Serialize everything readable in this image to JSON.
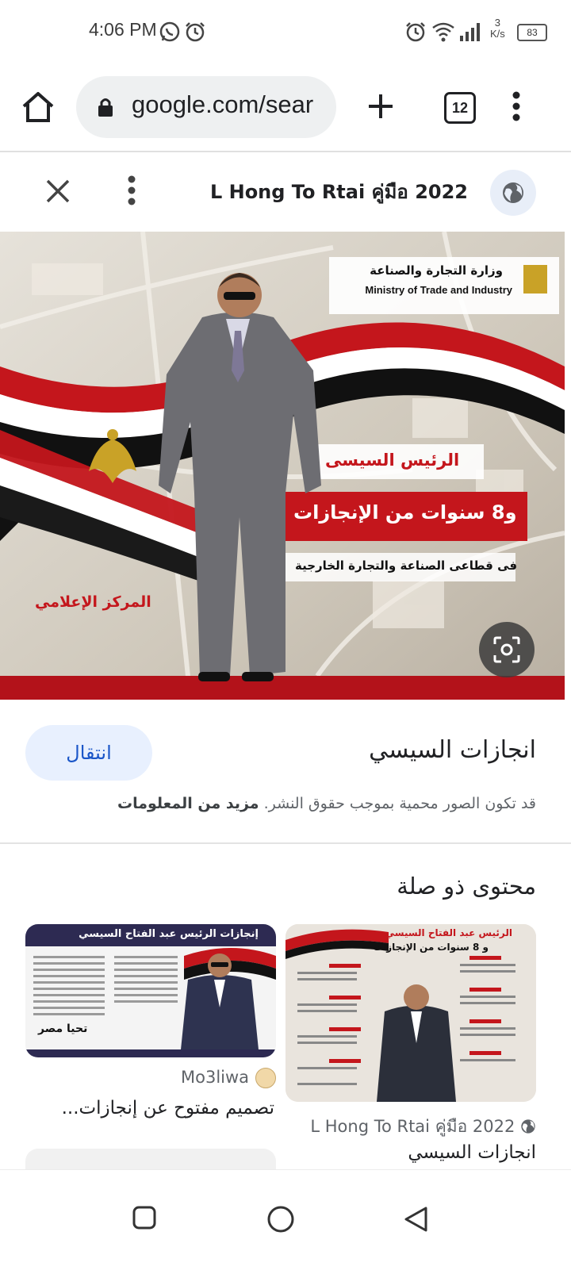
{
  "status_bar": {
    "time": "4:06 PM",
    "net_speed_value": "3",
    "net_speed_unit": "K/s",
    "battery": "83",
    "icons": [
      "whatsapp-icon",
      "alarm-icon",
      "alarm-icon",
      "wifi-icon",
      "signal-icon",
      "battery-icon"
    ]
  },
  "browser": {
    "url": "google.com/sear",
    "tab_count": "12",
    "icons": [
      "home-icon",
      "lock-icon",
      "plus-icon",
      "tabs-icon",
      "overflow-menu-icon"
    ]
  },
  "viewer": {
    "source_title": "L Hong To Rtai คู่มือ 2022",
    "icons": [
      "close-icon",
      "more-vert-icon",
      "globe-icon",
      "lens-icon"
    ]
  },
  "hero": {
    "ministry_ar": "وزارة التجارة والصناعة",
    "ministry_en": "Ministry of Trade and Industry",
    "headline_1": "الرئيس السيسى",
    "headline_2": "و8 سنوات من الإنجازات",
    "headline_3": "فى قطاعى الصناعة والتجارة الخارجية",
    "footer_label": "المركز الإعلامي",
    "colors": {
      "red": "#c4161c",
      "black": "#111111",
      "white": "#ffffff",
      "gold": "#c9a227"
    }
  },
  "result": {
    "title": "انجازات السيسي",
    "visit_label": "انتقال",
    "copyright_text": "قد تكون الصور محمية بموجب حقوق النشر.",
    "copyright_link": "مزيد من المعلومات"
  },
  "related": {
    "heading": "محتوى ذو صلة",
    "items": [
      {
        "image_caption_1": "الرئيس عبد الفتاح السيسي",
        "image_caption_2": "و 8 سنوات من الإنجازات",
        "source": "L Hong To Rtai คู่มือ 2022",
        "title": "انجازات السيسي"
      },
      {
        "image_caption_1": "إنجازات الرئيس عبد الفتاح السيسي",
        "image_caption_2": "تحيا مصر",
        "source": "Mo3liwa",
        "title": "تصميم مفتوح عن إنجازات..."
      }
    ]
  },
  "navbar": {
    "icons": [
      "recents-square-icon",
      "home-circle-icon",
      "back-triangle-icon"
    ]
  }
}
